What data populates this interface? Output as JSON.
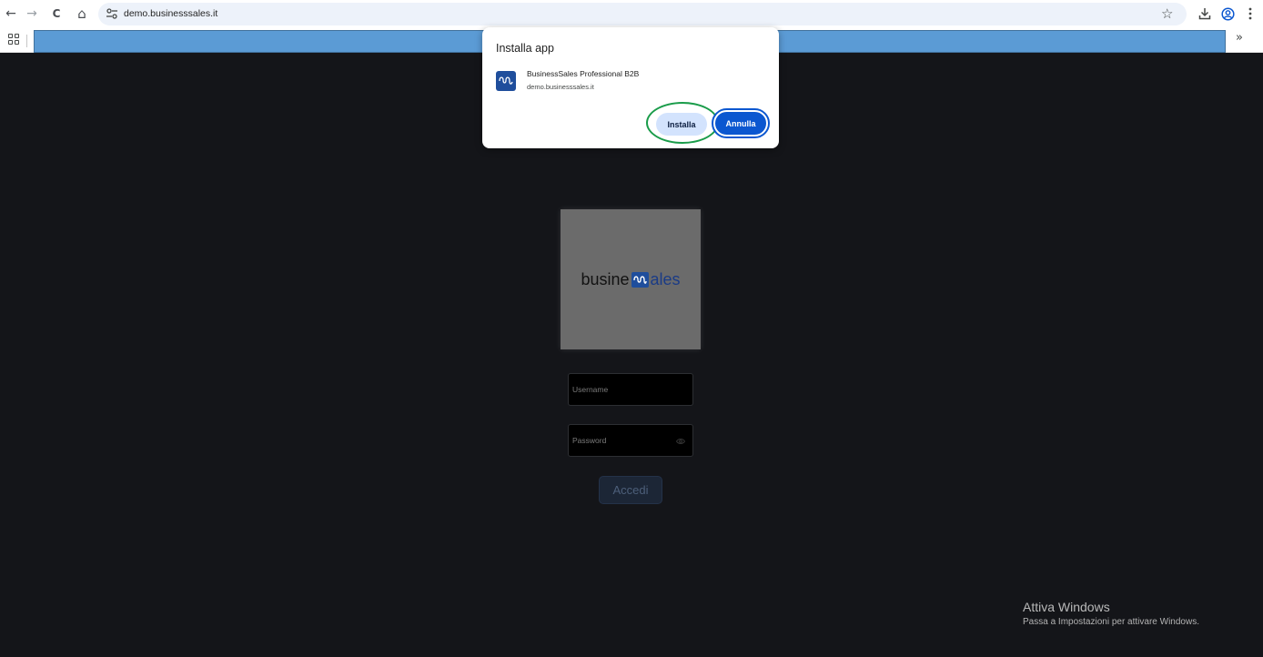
{
  "browser": {
    "url": "demo.businesssales.it",
    "nav": {
      "back": "←",
      "forward": "→",
      "reload": "C",
      "home": "⌂"
    },
    "star_glyph": "☆",
    "bookmarks_more": "»"
  },
  "install_dialog": {
    "title": "Installa app",
    "app_name": "BusinessSales Professional B2B",
    "app_origin": "demo.businesssales.it",
    "install_label": "Installa",
    "cancel_label": "Annulla"
  },
  "login": {
    "logo": {
      "left": "busine",
      "right": "ales"
    },
    "username_placeholder": "Username",
    "password_placeholder": "Password",
    "submit_label": "Accedi"
  },
  "watermark": {
    "title": "Attiva Windows",
    "subtitle": "Passa a Impostazioni per attivare Windows."
  },
  "colors": {
    "page_background": "#141519",
    "primary_button": "#0b57d0",
    "tonal_button": "#d3e3fd",
    "highlight_ring": "#1a9c4a",
    "bookmark_highlight": "#5b9bd5",
    "brand_blue": "#1f4e9c"
  }
}
